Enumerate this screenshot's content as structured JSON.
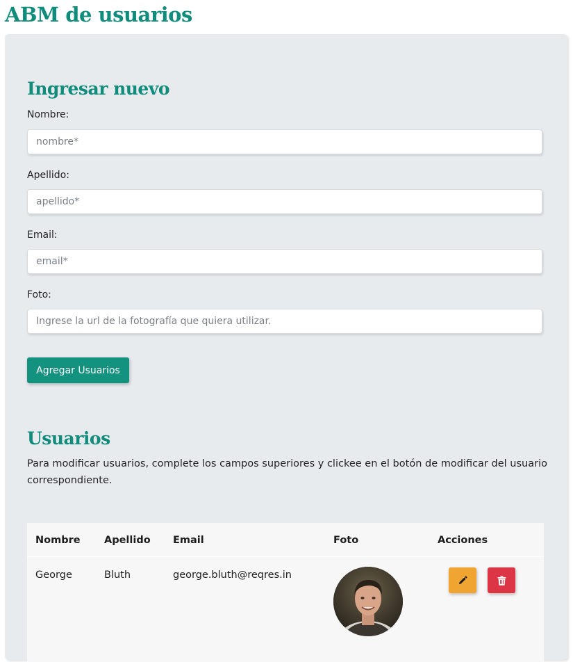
{
  "page": {
    "title": "ABM de usuarios"
  },
  "form": {
    "heading": "Ingresar nuevo",
    "fields": [
      {
        "label": "Nombre:",
        "placeholder": "nombre*",
        "value": ""
      },
      {
        "label": "Apellido:",
        "placeholder": "apellido*",
        "value": ""
      },
      {
        "label": "Email:",
        "placeholder": "email*",
        "value": ""
      },
      {
        "label": "Foto:",
        "placeholder": "Ingrese la url de la fotografía que quiera utilizar.",
        "value": ""
      }
    ],
    "submit_label": "Agregar Usuarios"
  },
  "users": {
    "heading": "Usuarios",
    "description": "Para modificar usuarios, complete los campos superiores y clickee en el botón de modificar del usuario correspondiente.",
    "columns": [
      "Nombre",
      "Apellido",
      "Email",
      "Foto",
      "Acciones"
    ],
    "rows": [
      {
        "nombre": "George",
        "apellido": "Bluth",
        "email": "george.bluth@reqres.in",
        "foto": "avatar photo"
      }
    ]
  },
  "icons": {
    "edit": "pencil-icon",
    "delete": "trash-icon"
  },
  "colors": {
    "accent": "#0f8c7c",
    "edit": "#f0a532",
    "delete": "#dc3545",
    "panel": "#e8ebee"
  }
}
